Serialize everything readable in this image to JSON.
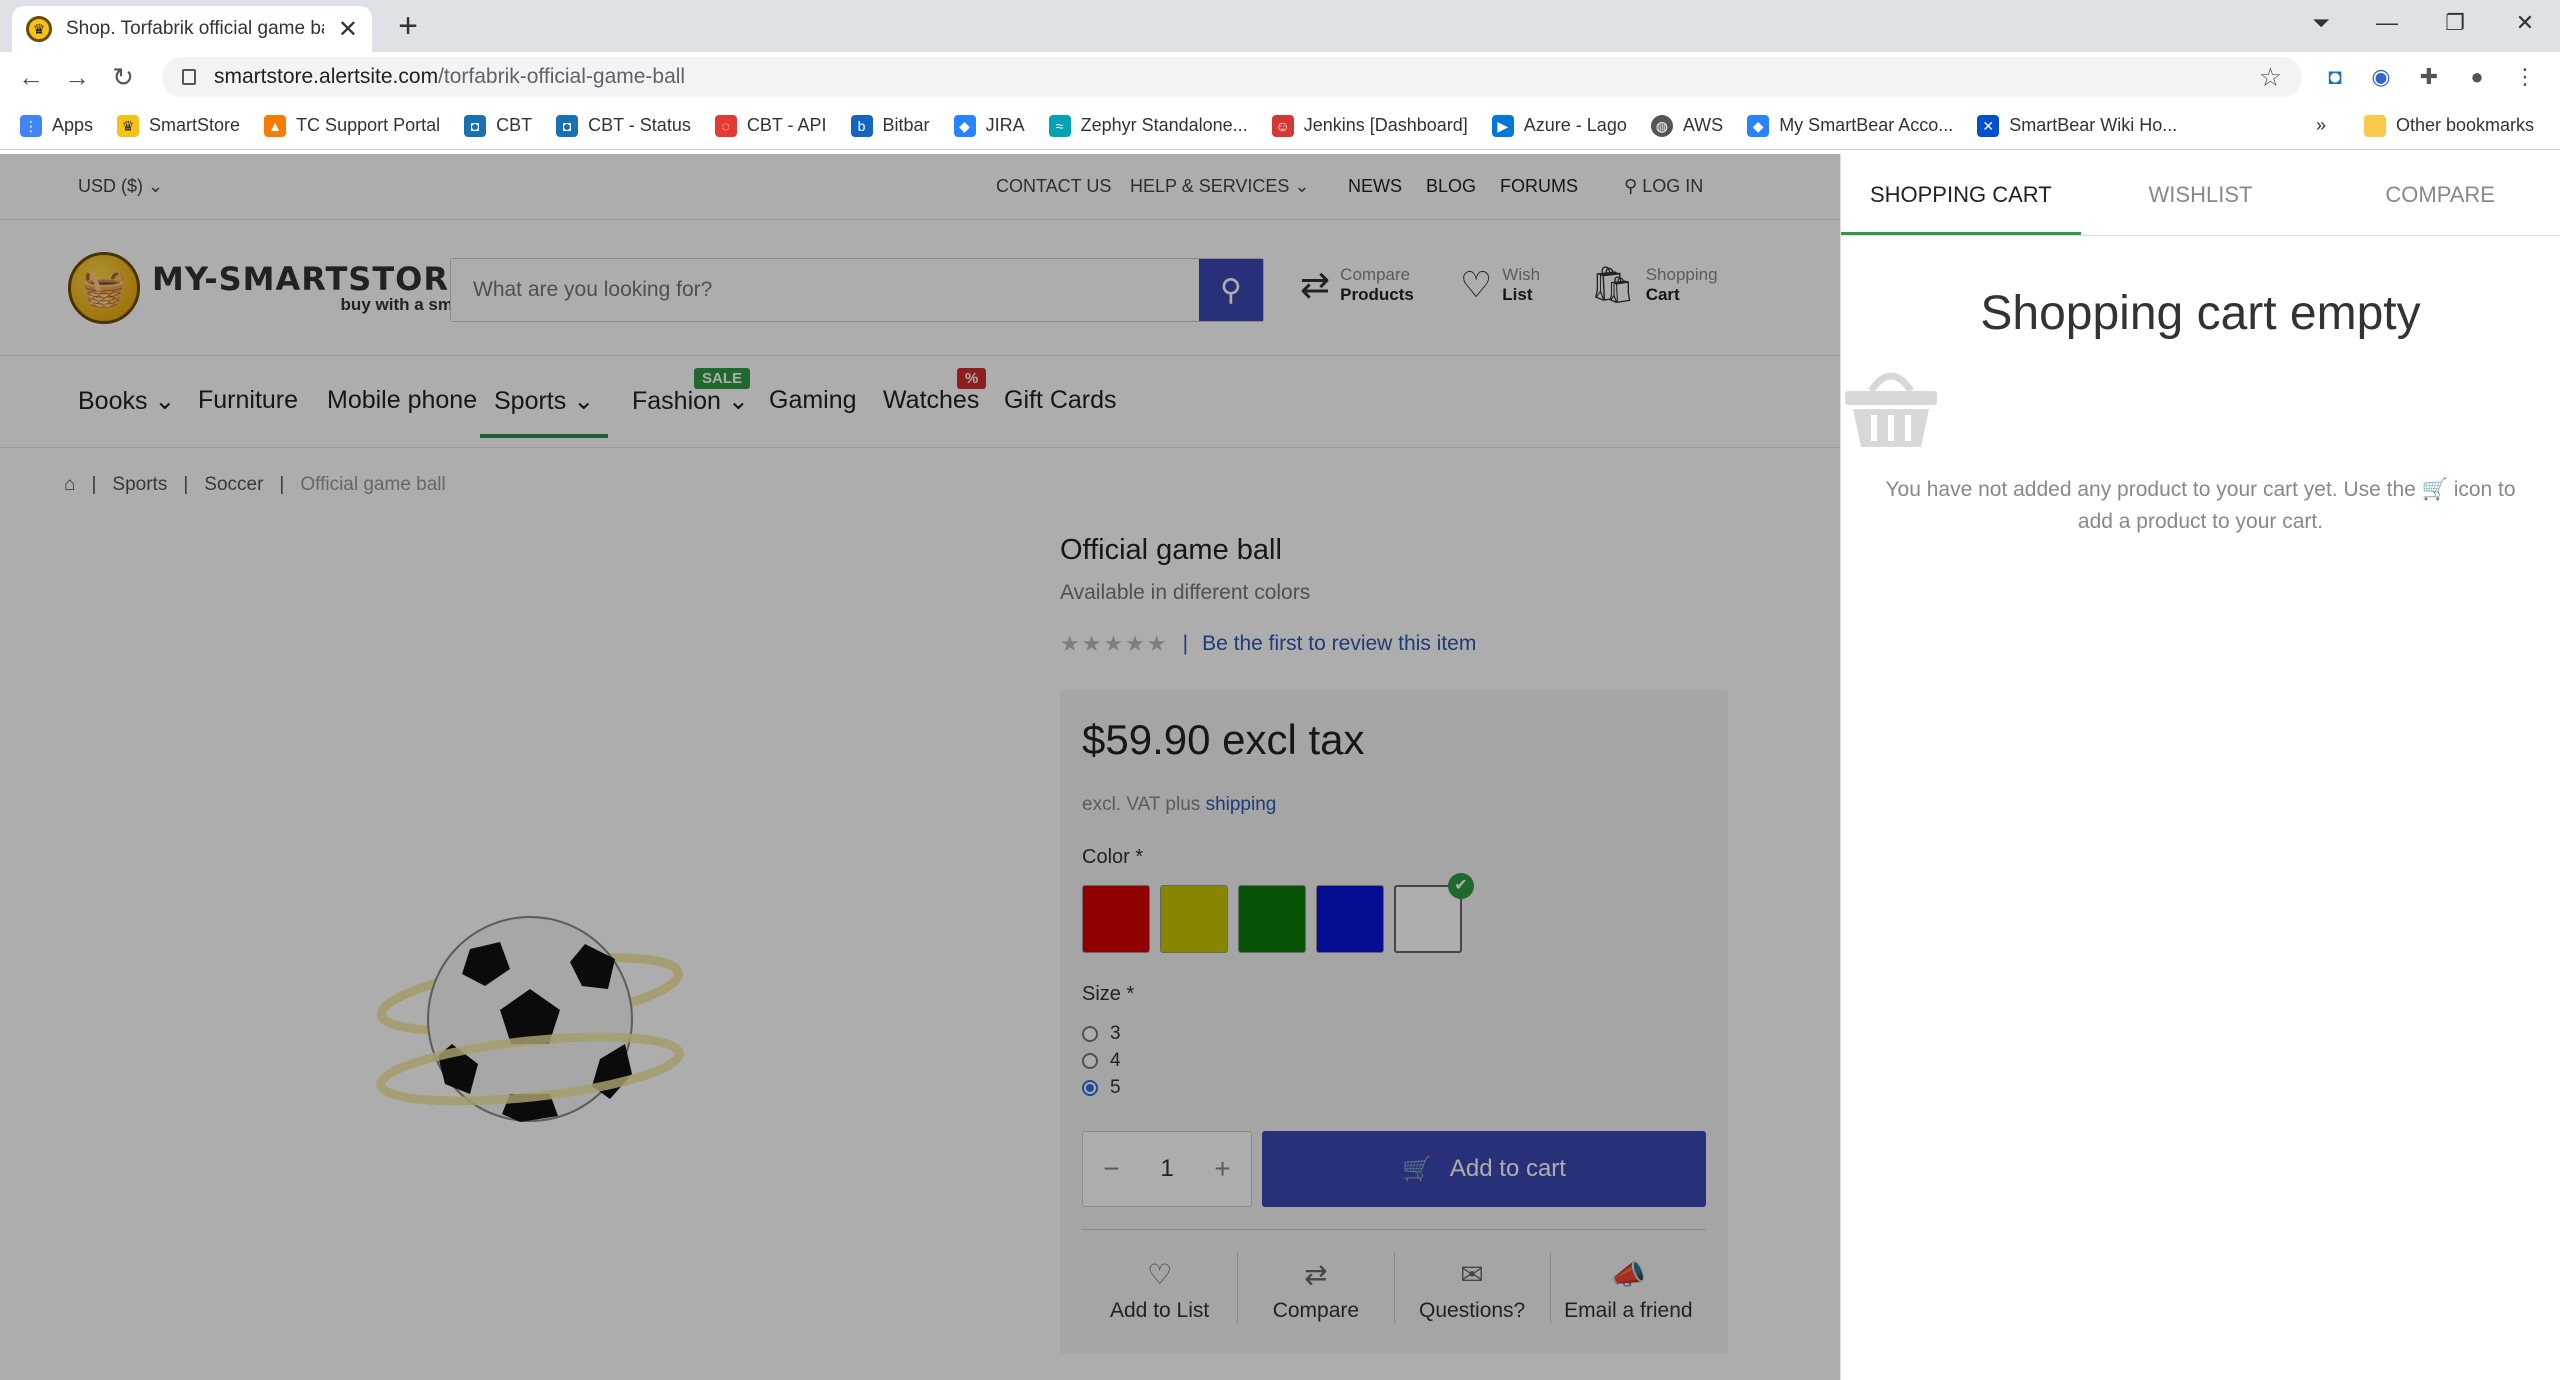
{
  "browser": {
    "tab_title": "Shop. Torfabrik official game ball",
    "url_host": "smartstore.alertsite.com",
    "url_path": "/torfabrik-official-game-ball",
    "bookmarks": [
      "Apps",
      "SmartStore",
      "TC Support Portal",
      "CBT",
      "CBT - Status",
      "CBT - API",
      "Bitbar",
      "JIRA",
      "Zephyr Standalone...",
      "Jenkins [Dashboard]",
      "Azure - Lago",
      "AWS",
      "My SmartBear Acco...",
      "SmartBear Wiki Ho..."
    ],
    "other_bookmarks": "Other bookmarks",
    "more": "»"
  },
  "topbar": {
    "currency": "USD ($)",
    "contact": "CONTACT US",
    "help": "HELP & SERVICES",
    "news": "NEWS",
    "blog": "BLOG",
    "forums": "FORUMS",
    "login": "LOG IN"
  },
  "header": {
    "logo_name": "MY-SMARTSTORE",
    "logo_tag": "buy with a smile",
    "search_placeholder": "What are you looking for?",
    "compare_top": "Compare",
    "compare_bottom": "Products",
    "wish_top": "Wish",
    "wish_bottom": "List",
    "cart_top": "Shopping",
    "cart_bottom": "Cart"
  },
  "menu": {
    "books": "Books",
    "furniture": "Furniture",
    "mobile": "Mobile phone",
    "sports": "Sports",
    "fashion": "Fashion",
    "gaming": "Gaming",
    "watches": "Watches",
    "giftcards": "Gift Cards",
    "sale_badge": "SALE",
    "pct_badge": "%"
  },
  "breadcrumb": {
    "sep": "|",
    "sports": "Sports",
    "soccer": "Soccer",
    "current": "Official game ball"
  },
  "product": {
    "title": "Official game ball",
    "subtitle": "Available in different colors",
    "review_link": "Be the first to review this item",
    "rating_sep": "|",
    "price": "$59.90 excl tax",
    "vat_prefix": "excl. VAT plus",
    "vat_link": "shipping",
    "color_label": "Color *",
    "colors": [
      "#d40000",
      "#c9c400",
      "#0a7a0a",
      "#0a14d6",
      "#ffffff"
    ],
    "selected_color_index": 4,
    "size_label": "Size *",
    "sizes": [
      "3",
      "4",
      "5"
    ],
    "selected_size": "5",
    "quantity": "1",
    "add_to_cart": "Add to cart",
    "actions": [
      "Add to List",
      "Compare",
      "Questions?",
      "Email a friend"
    ]
  },
  "panel": {
    "tabs": [
      "SHOPPING CART",
      "WISHLIST",
      "COMPARE"
    ],
    "empty_heading": "Shopping cart empty",
    "empty_text_1": "You have not added any product to your cart yet. Use the",
    "empty_text_2": "icon to add a product to your cart."
  }
}
